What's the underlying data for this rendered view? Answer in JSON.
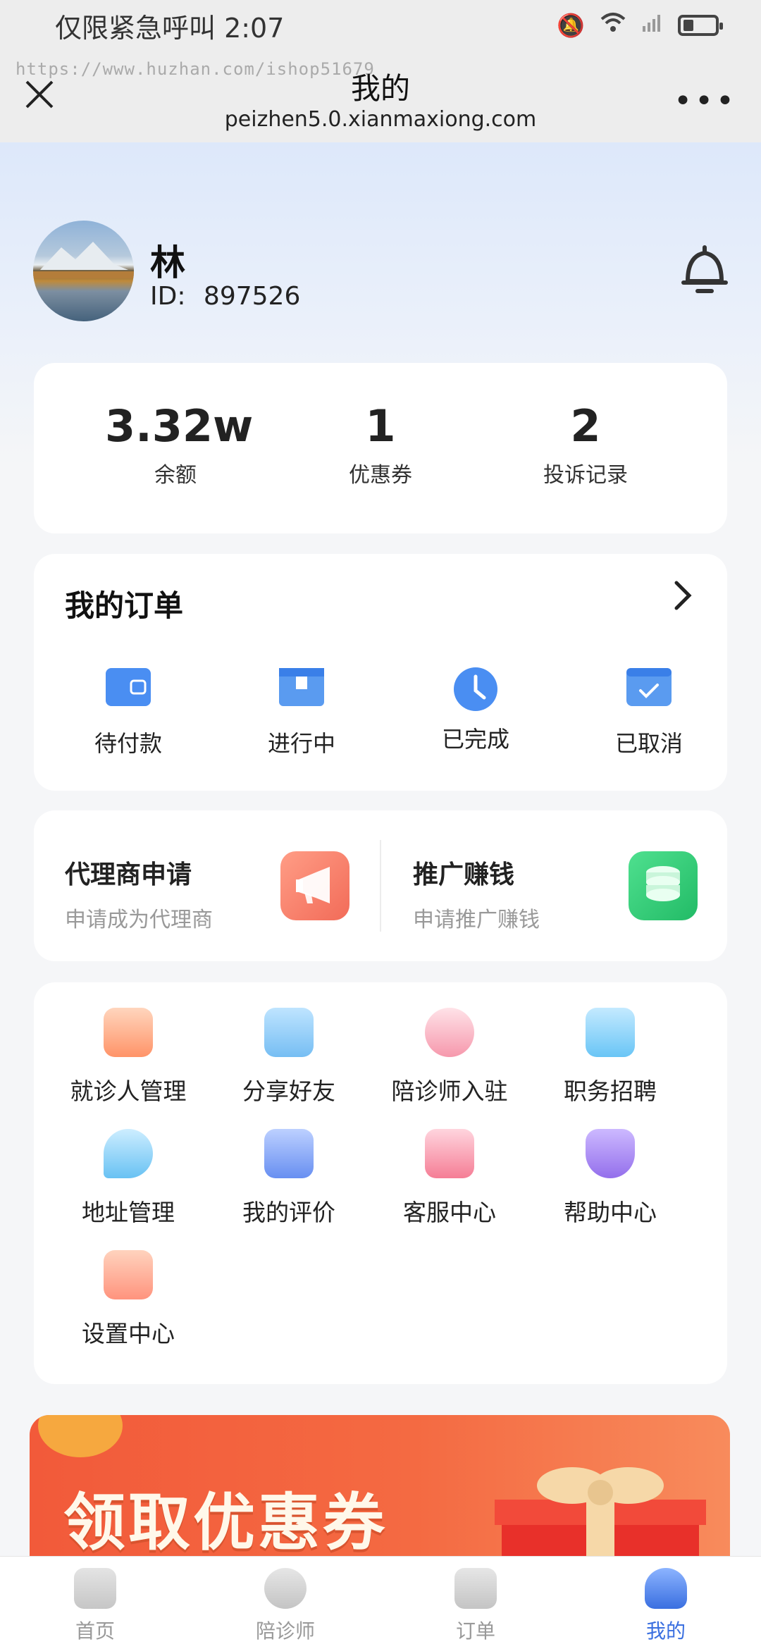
{
  "status_bar": {
    "carrier_time": "仅限紧急呼叫 2:07"
  },
  "nav": {
    "watermark": "https://www.huzhan.com/ishop51679",
    "close_icon": "close-icon",
    "title": "我的",
    "url": "peizhen5.0.xianmaxiong.com",
    "more": "•••"
  },
  "profile": {
    "name": "林",
    "id_label": "ID:",
    "id_value": "897526"
  },
  "stats": [
    {
      "value": "3.32w",
      "label": "余额"
    },
    {
      "value": "1",
      "label": "优惠券"
    },
    {
      "value": "2",
      "label": "投诉记录"
    }
  ],
  "orders": {
    "title": "我的订单",
    "items": [
      {
        "label": "待付款",
        "icon": "wallet-icon"
      },
      {
        "label": "进行中",
        "icon": "box-icon"
      },
      {
        "label": "已完成",
        "icon": "clock-icon"
      },
      {
        "label": "已取消",
        "icon": "check-card-icon"
      }
    ]
  },
  "promo": {
    "agent": {
      "title": "代理商申请",
      "subtitle": "申请成为代理商",
      "icon": "megaphone-icon"
    },
    "earn": {
      "title": "推广赚钱",
      "subtitle": "申请推广赚钱",
      "icon": "coins-icon"
    }
  },
  "services": [
    {
      "label": "就诊人管理",
      "icon": "patient-icon"
    },
    {
      "label": "分享好友",
      "icon": "share-icon"
    },
    {
      "label": "陪诊师入驻",
      "icon": "escort-icon"
    },
    {
      "label": "职务招聘",
      "icon": "folder-icon"
    },
    {
      "label": "地址管理",
      "icon": "location-icon"
    },
    {
      "label": "我的评价",
      "icon": "review-icon"
    },
    {
      "label": "客服中心",
      "icon": "chat-icon"
    },
    {
      "label": "帮助中心",
      "icon": "shield-check-icon"
    },
    {
      "label": "设置中心",
      "icon": "settings-icon"
    }
  ],
  "banner": {
    "text": "领取优惠券"
  },
  "tabs": [
    {
      "label": "首页",
      "icon": "home-icon"
    },
    {
      "label": "陪诊师",
      "icon": "escort-tab-icon"
    },
    {
      "label": "订单",
      "icon": "order-tab-icon"
    },
    {
      "label": "我的",
      "icon": "profile-tab-icon",
      "active": true
    }
  ],
  "colors": {
    "accent": "#3a6fe0",
    "promo_orange": "#f6876d",
    "promo_green": "#33cc77",
    "banner": "#f25a3a"
  }
}
